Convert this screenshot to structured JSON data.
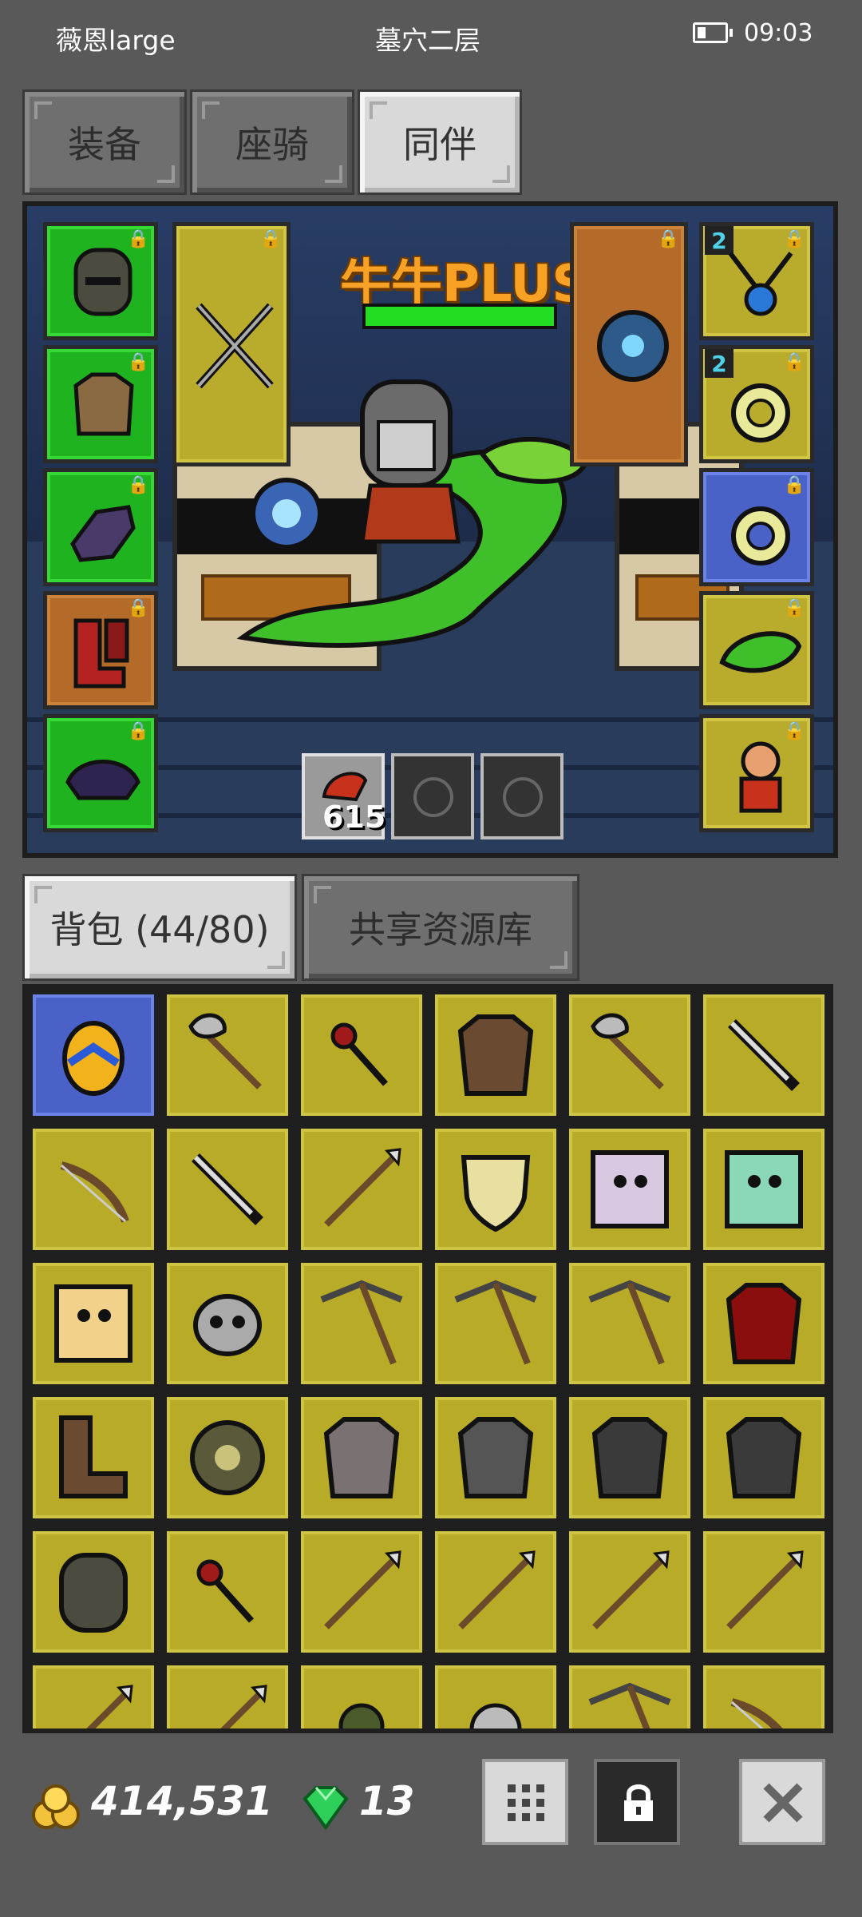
{
  "status": {
    "player": "薇恩large",
    "location": "墓穴二层",
    "time": "09:03"
  },
  "top_tabs": [
    {
      "label": "装备",
      "active": false
    },
    {
      "label": "座骑",
      "active": false
    },
    {
      "label": "同伴",
      "active": true
    }
  ],
  "companion": {
    "name": "牛牛PLUS",
    "hp_fraction": 1.0,
    "left_slots": [
      {
        "item": "helmet-icon",
        "rarity": "green"
      },
      {
        "item": "chest-armor-icon",
        "rarity": "green"
      },
      {
        "item": "gloves-icon",
        "rarity": "green"
      },
      {
        "item": "boots-icon",
        "rarity": "orange"
      },
      {
        "item": "shoulder-pads-icon",
        "rarity": "green"
      }
    ],
    "weapon_slot": {
      "item": "crossed-weapons-icon",
      "rarity": "yellow"
    },
    "offhand_slot": {
      "item": "blue-orb-icon",
      "rarity": "orange"
    },
    "right_slots": [
      {
        "item": "amulet-icon",
        "rarity": "yellow",
        "level": "2"
      },
      {
        "item": "ring-icon",
        "rarity": "yellow",
        "level": "2"
      },
      {
        "item": "ring-icon",
        "rarity": "blue",
        "level": ""
      },
      {
        "item": "green-serpent-icon",
        "rarity": "yellow",
        "level": ""
      },
      {
        "item": "figure-icon",
        "rarity": "yellow",
        "level": ""
      }
    ],
    "bottom_slots": [
      {
        "item": "red-bird-icon",
        "count": "615"
      },
      {
        "item": "empty-slot-icon",
        "count": ""
      },
      {
        "item": "empty-slot-icon",
        "count": ""
      }
    ]
  },
  "bag_tabs": [
    {
      "label": "背包 (44/80)",
      "active": true
    },
    {
      "label": "共享资源库",
      "active": false
    }
  ],
  "inventory": [
    [
      "egg-icon",
      "double-axe-icon",
      "mace-icon",
      "leather-armor-icon",
      "battle-axe-icon",
      "sword-icon"
    ],
    [
      "bow-icon",
      "dagger-icon",
      "spear-icon",
      "shield-icon",
      "pet-cow-card-icon",
      "pet-frog-card-icon"
    ],
    [
      "pet-bird-card-icon",
      "horned-skull-icon",
      "crossbow-icon",
      "crossbow-icon",
      "crossbow-icon",
      "red-demon-armor-icon"
    ],
    [
      "boots-icon",
      "round-shield-icon",
      "chainmail-icon",
      "plate-armor-icon",
      "dark-armor-icon",
      "dark-armor-icon"
    ],
    [
      "helmet-icon",
      "mace-icon",
      "spear-icon",
      "spear-icon",
      "staff-icon",
      "staff-icon"
    ],
    [
      "trident-icon",
      "trident-icon",
      "spiked-ball-icon",
      "stone-icon",
      "crossbow-icon",
      "bow-icon"
    ]
  ],
  "footer": {
    "gold": "414,531",
    "gems": "13"
  }
}
